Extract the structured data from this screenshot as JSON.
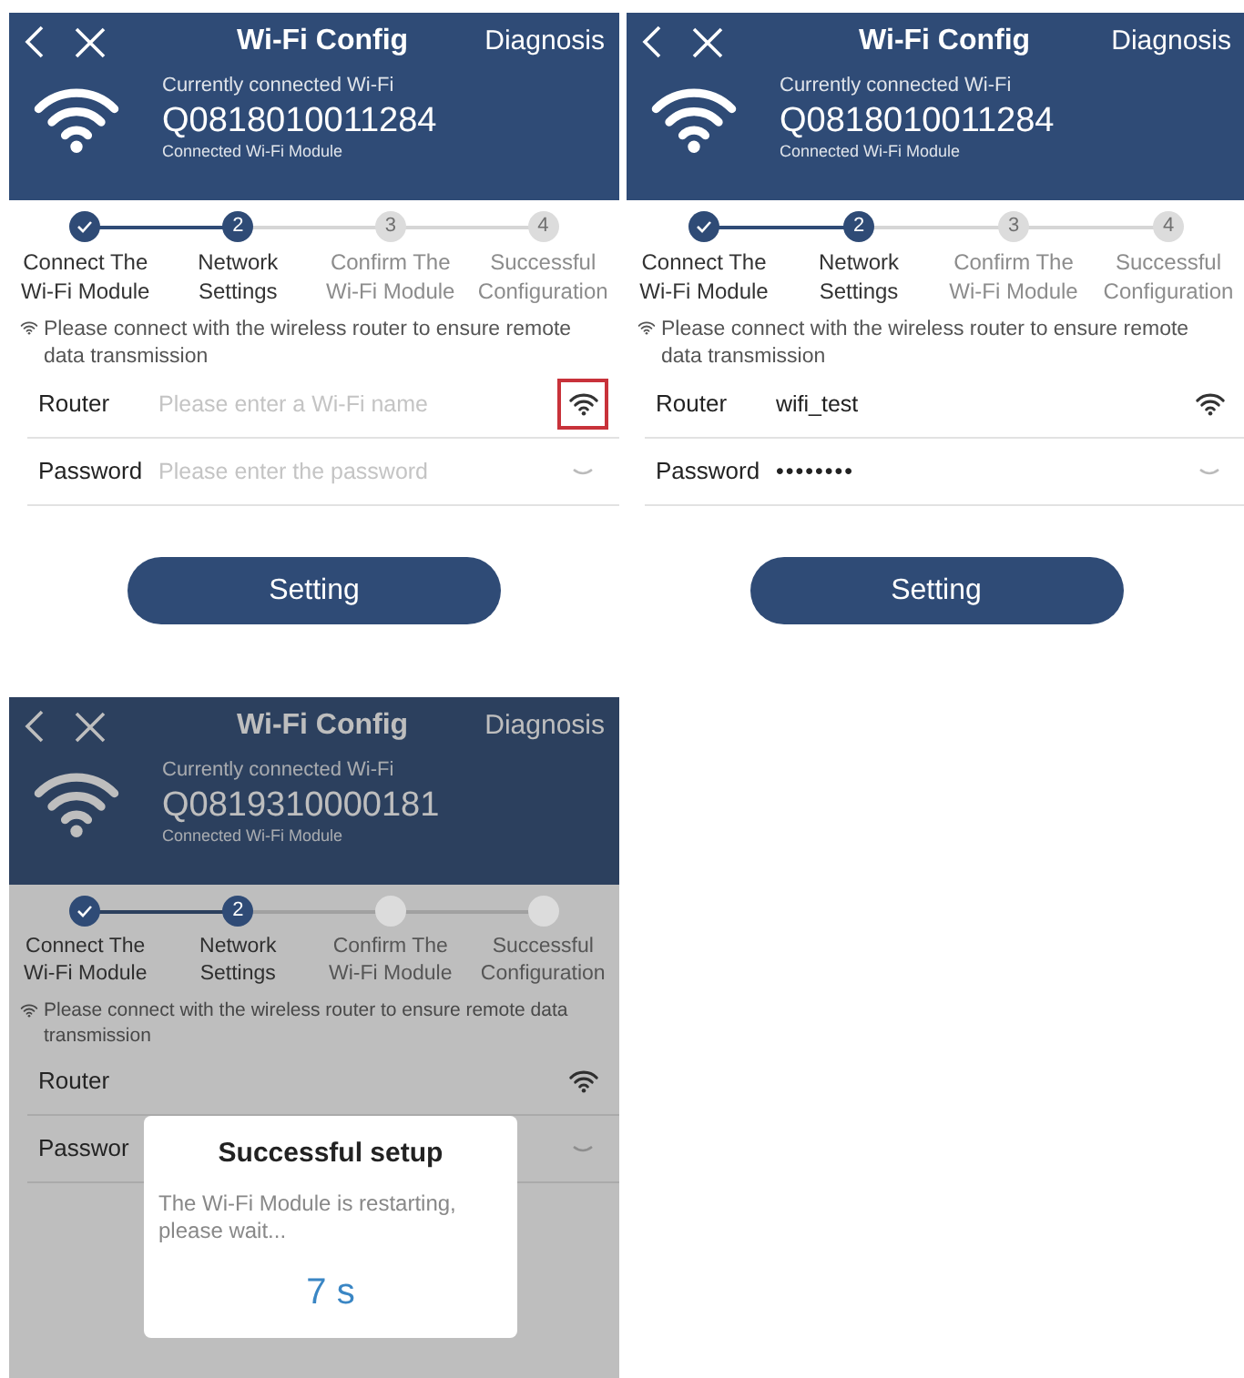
{
  "screens": [
    {
      "header": {
        "title": "Wi-Fi Config",
        "action": "Diagnosis",
        "caption": "Currently connected Wi-Fi",
        "ssid": "Q0818010011284",
        "subcaption": "Connected Wi-Fi Module"
      },
      "steps": [
        {
          "label": "Connect The Wi-Fi Module",
          "completed": true,
          "reached": true
        },
        {
          "number": "2",
          "label": "Network Settings",
          "completed": false,
          "reached": true
        },
        {
          "number": "3",
          "label": "Confirm The Wi-Fi Module",
          "completed": false,
          "reached": false
        },
        {
          "number": "4",
          "label": "Successful Configuration",
          "completed": false,
          "reached": false
        }
      ],
      "notice": "Please connect with the wireless router to ensure remote data transmission",
      "fields": [
        {
          "label": "Router",
          "kind": "text",
          "placeholder": "Please enter a Wi-Fi name",
          "trailing": {
            "kind": "wifi",
            "highlighted": true
          }
        },
        {
          "label": "Password",
          "kind": "password",
          "placeholder": "Please enter the password",
          "trailing": {
            "kind": "chevron",
            "highlighted": false
          }
        }
      ],
      "button": "Setting"
    },
    {
      "header": {
        "title": "Wi-Fi Config",
        "action": "Diagnosis",
        "caption": "Currently connected Wi-Fi",
        "ssid": "Q0818010011284",
        "subcaption": "Connected Wi-Fi Module"
      },
      "steps": [
        {
          "label": "Connect The Wi-Fi Module",
          "completed": true,
          "reached": true
        },
        {
          "number": "2",
          "label": "Network Settings",
          "completed": false,
          "reached": true
        },
        {
          "number": "3",
          "label": "Confirm The Wi-Fi Module",
          "completed": false,
          "reached": false
        },
        {
          "number": "4",
          "label": "Successful Configuration",
          "completed": false,
          "reached": false
        }
      ],
      "notice": "Please connect with the wireless router to ensure remote data transmission",
      "fields": [
        {
          "label": "Router",
          "kind": "text",
          "value": "wifi_test",
          "trailing": {
            "kind": "wifi",
            "highlighted": false
          }
        },
        {
          "label": "Password",
          "kind": "password",
          "value": "••••••••",
          "trailing": {
            "kind": "chevron",
            "highlighted": false
          }
        }
      ],
      "button": "Setting"
    },
    {
      "header": {
        "title": "Wi-Fi Config",
        "action": "Diagnosis",
        "caption": "Currently connected Wi-Fi",
        "ssid": "Q0819310000181",
        "subcaption": "Connected Wi-Fi Module"
      },
      "steps": [
        {
          "label": "Connect The Wi-Fi Module",
          "completed": true,
          "reached": true
        },
        {
          "number": "2",
          "label": "Network Settings",
          "completed": false,
          "reached": true
        },
        {
          "label": "Confirm The Wi-Fi Module",
          "completed": false,
          "reached": false
        },
        {
          "label": "Successful Configuration",
          "completed": false,
          "reached": false
        }
      ],
      "notice": "Please connect with the wireless router to ensure remote data transmission",
      "fields": [
        {
          "label": "Router",
          "trailing": {
            "kind": "wifi",
            "highlighted": false
          }
        },
        {
          "label": "Passwor",
          "trailing": {
            "kind": "chevron",
            "highlighted": false
          }
        }
      ],
      "dialog": {
        "title": "Successful setup",
        "message": "The Wi-Fi Module is restarting, please wait...",
        "countdown": "7 s"
      }
    }
  ]
}
